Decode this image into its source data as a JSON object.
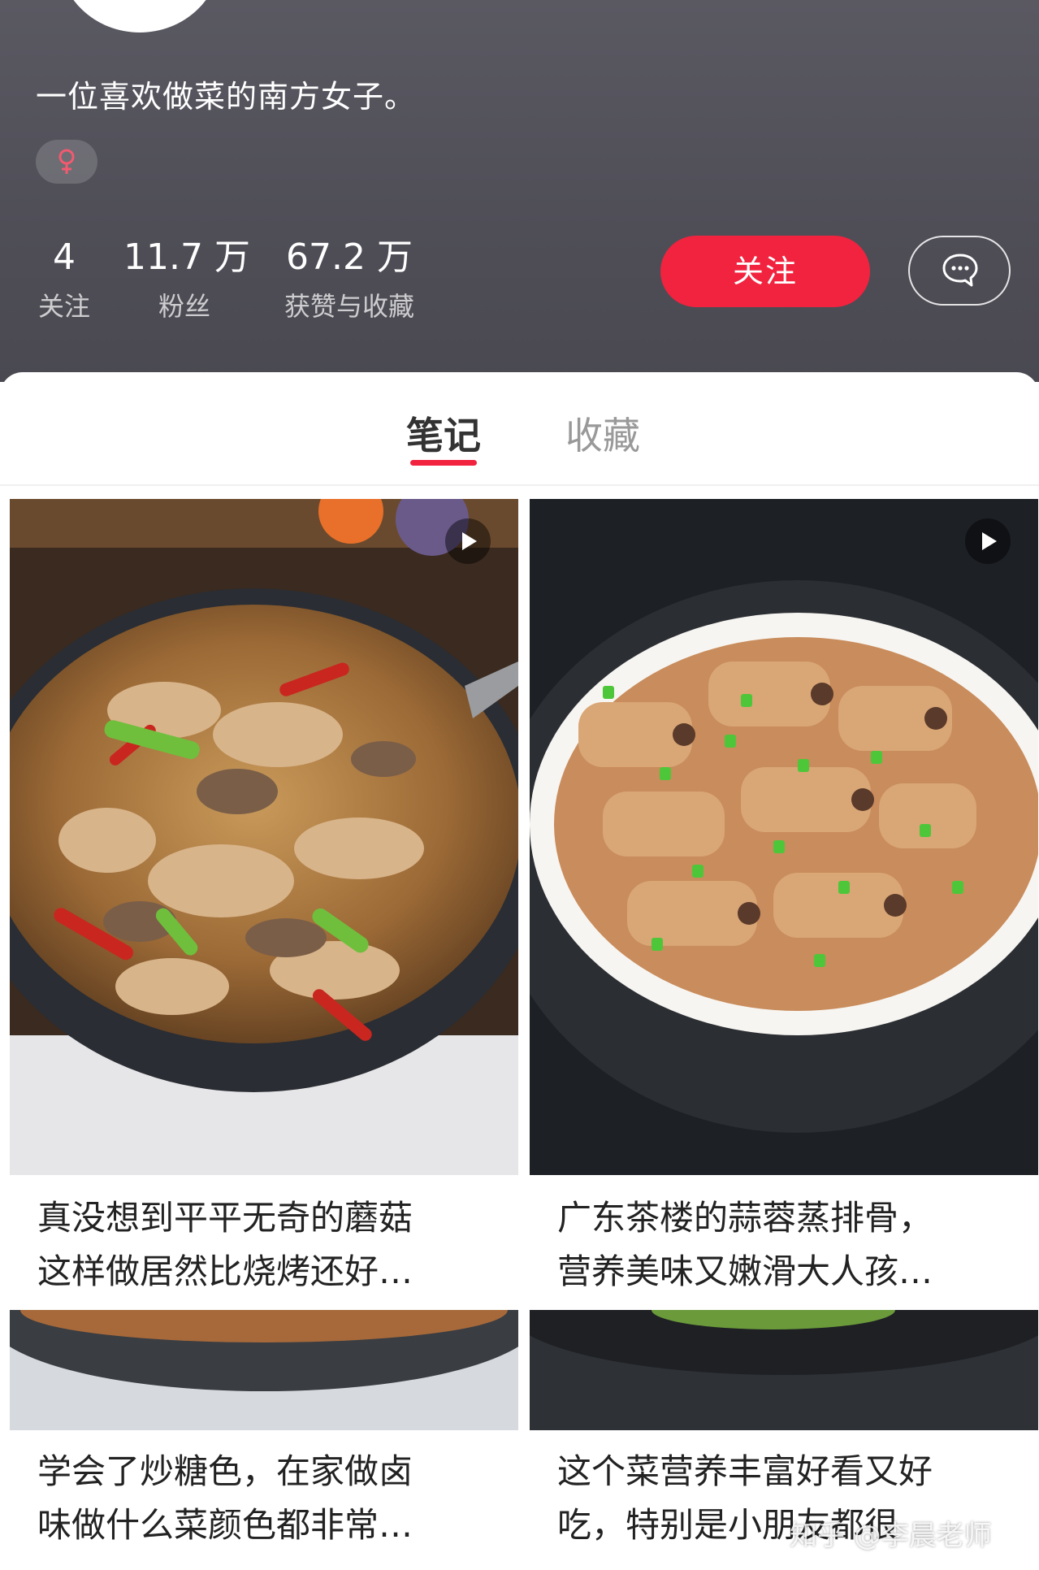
{
  "profile": {
    "bio": "一位喜欢做菜的南方女子。",
    "gender_icon": "female-icon",
    "stats": [
      {
        "value": "4",
        "label": "关注"
      },
      {
        "value": "11.7 万",
        "label": "粉丝"
      },
      {
        "value": "67.2 万",
        "label": "获赞与收藏"
      }
    ],
    "follow_label": "关注",
    "message_icon": "chat-bubble-icon",
    "accent_color": "#f1233f"
  },
  "tabs": [
    {
      "label": "笔记",
      "active": true
    },
    {
      "label": "收藏",
      "active": false
    }
  ],
  "notes": [
    {
      "title_line1": "真没想到平平无奇的蘑菇",
      "title_line2": "这样做居然比烧烤还好…",
      "has_video": true
    },
    {
      "title_line1": "广东茶楼的蒜蓉蒸排骨，",
      "title_line2": "营养美味又嫩滑大人孩…",
      "has_video": true
    },
    {
      "title_line1": "学会了炒糖色，在家做卤",
      "title_line2": "味做什么菜颜色都非常…",
      "has_video": false
    },
    {
      "title_line1": "这个菜营养丰富好看又好",
      "title_line2": "吃，特别是小朋友都很",
      "has_video": false
    }
  ],
  "watermark": "知乎 @李晨老师"
}
